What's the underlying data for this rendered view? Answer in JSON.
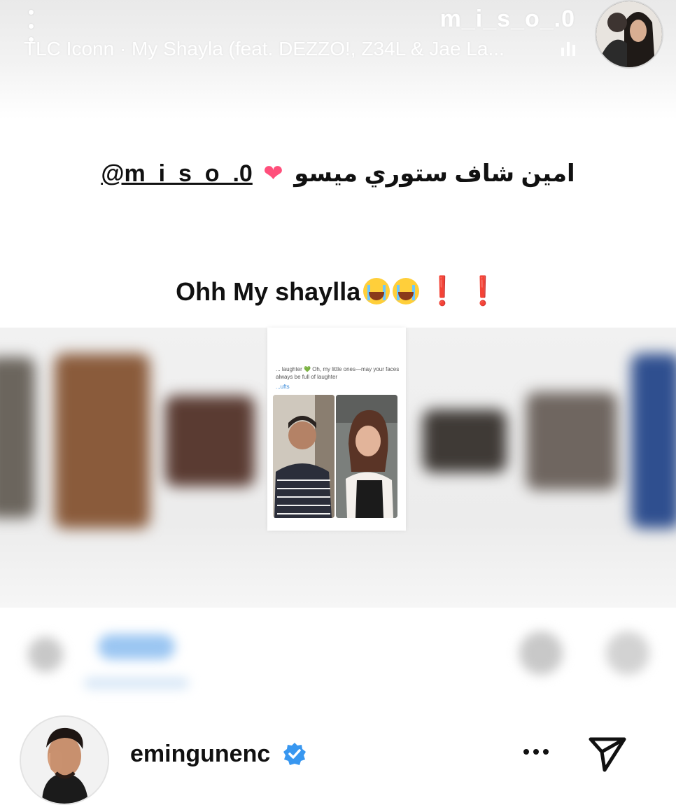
{
  "story": {
    "username": "m_i_s_o_.0",
    "music": "TLC Iconn · My Shayla (feat. DEZZO!, Z34L & Jae La..."
  },
  "content": {
    "arabic_text": "امين شاف ستوري ميسو",
    "mention": "@m_i_s_o_.0",
    "caption": "Ohh My shaylla"
  },
  "post_preview": {
    "snippet": "... laughter 💚 Oh, my little ones—may your faces always be full of laughter",
    "link": "...ufts"
  },
  "footer": {
    "account": "emingunenc",
    "verified": true
  },
  "colors": {
    "heart": "#ff4f7b",
    "exclamation": "#e0242d",
    "verified": "#3897f0"
  }
}
